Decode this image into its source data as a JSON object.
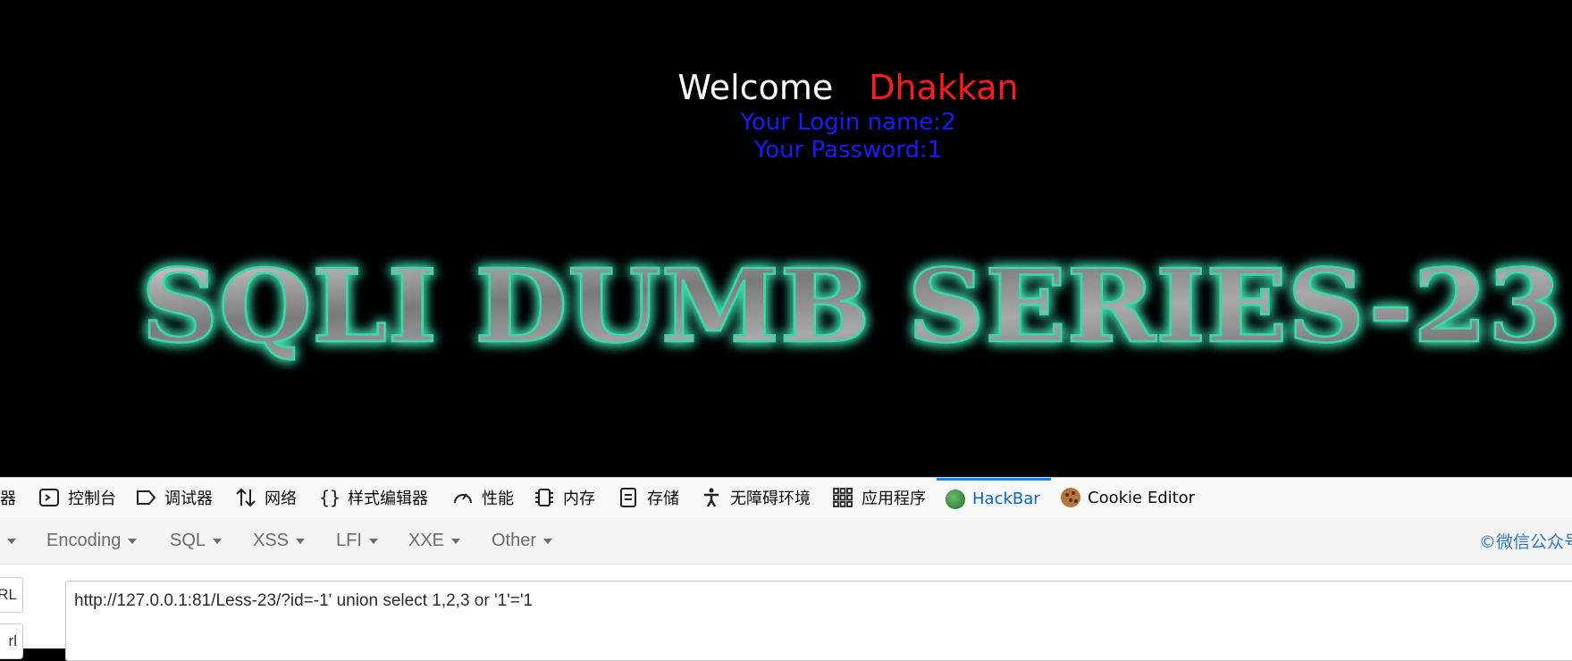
{
  "page": {
    "welcome": "Welcome",
    "user": "Dhakkan",
    "login_line": "Your Login name:2",
    "password_line": "Your Password:1",
    "banner": "SQLI DUMB SERIES-23"
  },
  "devtools": {
    "tabs": [
      {
        "label": "器",
        "icon": "inspector-icon"
      },
      {
        "label": "控制台",
        "icon": "console-icon"
      },
      {
        "label": "调试器",
        "icon": "debugger-icon"
      },
      {
        "label": "网络",
        "icon": "network-icon"
      },
      {
        "label": "样式编辑器",
        "icon": "style-editor-icon"
      },
      {
        "label": "性能",
        "icon": "performance-icon"
      },
      {
        "label": "内存",
        "icon": "memory-icon"
      },
      {
        "label": "存储",
        "icon": "storage-icon"
      },
      {
        "label": "无障碍环境",
        "icon": "accessibility-icon"
      },
      {
        "label": "应用程序",
        "icon": "application-icon"
      },
      {
        "label": "HackBar",
        "icon": "hackbar-icon",
        "active": true
      },
      {
        "label": "Cookie Editor",
        "icon": "cookie-icon"
      }
    ],
    "hackbar_menu": [
      "Encoding",
      "SQL",
      "XSS",
      "LFI",
      "XXE",
      "Other"
    ],
    "credit": "©微信公众号",
    "side_buttons": [
      "RL",
      "rl"
    ],
    "url_value": "http://127.0.0.1:81/Less-23/?id=-1' union select 1,2,3 or '1'='1"
  },
  "colors": {
    "welcome": "#ffffff",
    "user": "#ff1b1b",
    "info": "#1a1aff",
    "banner_glow": "#3fd6a8",
    "active_tab": "#0a63cf"
  }
}
